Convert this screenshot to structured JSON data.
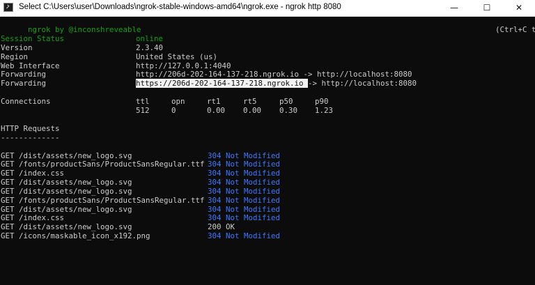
{
  "window": {
    "title": "Select C:\\Users\\user\\Downloads\\ngrok-stable-windows-amd64\\ngrok.exe - ngrok  http 8080",
    "buttons": {
      "minimize": "—",
      "maximize": "☐",
      "close": "✕"
    }
  },
  "header": {
    "left": "ngrok by @inconshreveable",
    "right": "(Ctrl+C to quit)"
  },
  "session": [
    {
      "label": "Session Status",
      "value": "online"
    },
    {
      "label": "Version",
      "value": "2.3.40"
    },
    {
      "label": "Region",
      "value": "United States (us)"
    },
    {
      "label": "Web Interface",
      "value": "http://127.0.0.1:4040"
    },
    {
      "label": "Forwarding",
      "value": "http://206d-202-164-137-218.ngrok.io -> http://localhost:8080"
    },
    {
      "label": "Forwarding",
      "selected": "https://206d-202-164-137-218.ngrok.io ",
      "value": "-> http://localhost:8080"
    }
  ],
  "connections": {
    "label": "Connections",
    "headers": [
      "ttl",
      "opn",
      "rt1",
      "rt5",
      "p50",
      "p90"
    ],
    "values": [
      "512",
      "0",
      "0.00",
      "0.00",
      "0.30",
      "1.23"
    ]
  },
  "http": {
    "title": "HTTP Requests",
    "underline": "-------------",
    "requests": [
      {
        "method": "GET",
        "path": "/dist/assets/new_logo.svg",
        "status": "304 Not Modified"
      },
      {
        "method": "GET",
        "path": "/fonts/productSans/ProductSansRegular.ttf",
        "status": "304 Not Modified"
      },
      {
        "method": "GET",
        "path": "/index.css",
        "status": "304 Not Modified"
      },
      {
        "method": "GET",
        "path": "/dist/assets/new_logo.svg",
        "status": "304 Not Modified"
      },
      {
        "method": "GET",
        "path": "/dist/assets/new_logo.svg",
        "status": "304 Not Modified"
      },
      {
        "method": "GET",
        "path": "/fonts/productSans/ProductSansRegular.ttf",
        "status": "304 Not Modified"
      },
      {
        "method": "GET",
        "path": "/dist/assets/new_logo.svg",
        "status": "304 Not Modified"
      },
      {
        "method": "GET",
        "path": "/index.css",
        "status": "304 Not Modified"
      },
      {
        "method": "GET",
        "path": "/dist/assets/new_logo.svg",
        "status": "200 OK"
      },
      {
        "method": "GET",
        "path": "/icons/maskable_icon_x192.png",
        "status": "304 Not Modified"
      }
    ]
  },
  "colors": {
    "background": "#0c0c0c",
    "text": "#cccccc",
    "online": "#13a10e",
    "status_304": "#3b78ff",
    "header": "#13a10e"
  }
}
